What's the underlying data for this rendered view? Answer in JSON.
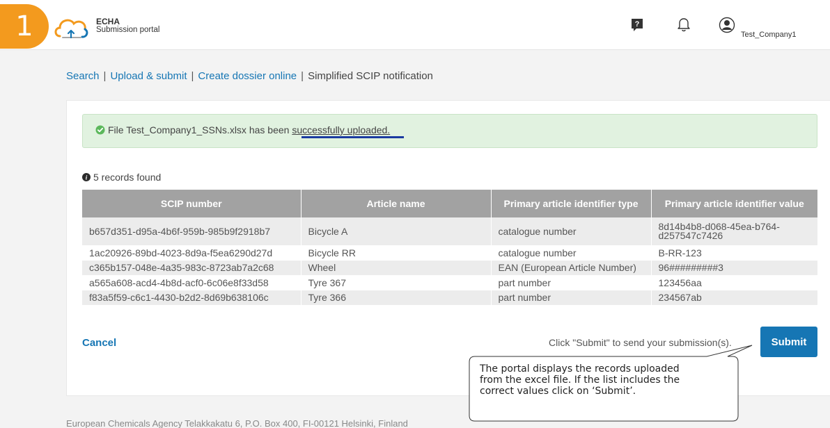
{
  "step_number": "1",
  "header": {
    "logo_line1": "ECHA",
    "logo_line2": "Submission portal",
    "user_name": "Test_Company1"
  },
  "breadcrumb": {
    "search": "Search",
    "upload_submit": "Upload & submit",
    "create_dossier": "Create dossier online",
    "current": "Simplified SCIP notification",
    "separator": "|"
  },
  "alert": {
    "prefix": "File Test_Company1_SSNs.xlsx has been ",
    "highlight": "successfully uploaded."
  },
  "records_found": "5 records found",
  "table": {
    "headers": [
      "SCIP number",
      "Article name",
      "Primary article identifier type",
      "Primary article identifier value"
    ],
    "rows": [
      [
        "b657d351-d95a-4b6f-959b-985b9f2918b7",
        "Bicycle A",
        "catalogue number",
        "8d14b4b8-d068-45ea-b764-d257547c7426"
      ],
      [
        "1ac20926-89bd-4023-8d9a-f5ea6290d27d",
        "Bicycle RR",
        "catalogue number",
        "B-RR-123"
      ],
      [
        "c365b157-048e-4a35-983c-8723ab7a2c68",
        "Wheel",
        "EAN (European Article Number)",
        "96#########3"
      ],
      [
        "a565a608-acd4-4b8d-acf0-6c06e8f33d58",
        "Tyre 367",
        "part number",
        "123456aa"
      ],
      [
        "f83a5f59-c6c1-4430-b2d2-8d69b638106c",
        "Tyre 366",
        "part number",
        "234567ab"
      ]
    ]
  },
  "actions": {
    "cancel_label": "Cancel",
    "submit_hint": "Click \"Submit\" to send your submission(s).",
    "submit_label": "Submit"
  },
  "callout_text": "The portal displays the records uploaded from the excel file. If the list includes the correct values click on ‘Submit’.",
  "footer": "European Chemicals Agency Telakkakatu 6, P.O. Box 400, FI-00121 Helsinki, Finland",
  "colors": {
    "accent": "#1676b4",
    "step_badge": "#f39a1e",
    "alert_bg": "#e1f2e0",
    "table_header": "#a2a2a2"
  }
}
